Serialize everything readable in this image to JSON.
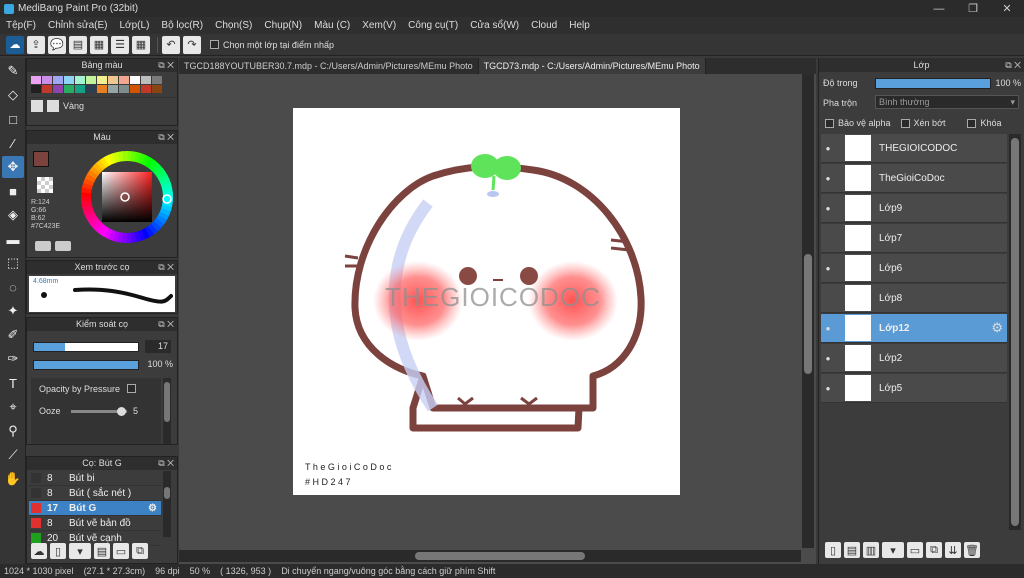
{
  "window": {
    "title": "MediBang Paint Pro (32bit)",
    "minimize": "—",
    "maximize": "❐",
    "close": "✕"
  },
  "menu": [
    "Tệp(F)",
    "Chỉnh sửa(E)",
    "Lớp(L)",
    "Bộ lọc(R)",
    "Chọn(S)",
    "Chụp(N)",
    "Màu (C)",
    "Xem(V)",
    "Công cụ(T)",
    "Cửa sổ(W)",
    "Cloud",
    "Help"
  ],
  "toolbar": {
    "select_layer_label": "Chọn một lớp tại điểm nhấp"
  },
  "palette": {
    "title": "Bảng màu",
    "colors": [
      "#e9a3f0",
      "#c98ee8",
      "#9fa6f2",
      "#8fd3f4",
      "#a3f2d2",
      "#c3f29d",
      "#f2f08f",
      "#f2c68f",
      "#f2a58f",
      "#ffffff",
      "#bdbdbd",
      "#7a7a7a",
      "#202020",
      "#c0392b",
      "#8e44ad",
      "#27ae60",
      "#16a085",
      "#2c3e50",
      "#e67e22",
      "#95a5a6",
      "#7f8c8d",
      "#d35400",
      "#c0392b",
      "#8b4513"
    ],
    "selected_name": "Vàng"
  },
  "color": {
    "title": "Màu",
    "r": "R:124",
    "g": "G:66",
    "b": "B:62",
    "hex": "#7C423E",
    "current": "#7c423e"
  },
  "brush_preview": {
    "title": "Xem trước cọ",
    "size": "4.68mm"
  },
  "brush_control": {
    "title": "Kiểm soát cọ",
    "size_value": "17",
    "opacity_value": "100 %",
    "size_fraction": 0.3,
    "opacity_fraction": 1.0,
    "pressure_label": "Opacity by Pressure",
    "ooze_label": "Ooze",
    "ooze_value": "5",
    "ooze_fraction": 0.9
  },
  "brushes": {
    "title": "Cọ: Bút G",
    "items": [
      {
        "size": "8",
        "name": "Bút bi",
        "color": "#333333"
      },
      {
        "size": "8",
        "name": "Bút ( sắc nét )",
        "color": "#333333"
      },
      {
        "size": "17",
        "name": "Bút G",
        "color": "#e03030",
        "selected": true
      },
      {
        "size": "8",
        "name": "Bút vẽ bản đồ",
        "color": "#e03030"
      },
      {
        "size": "20",
        "name": "Bút vẽ cạnh",
        "color": "#1fa01f"
      }
    ]
  },
  "tabs": [
    {
      "label": "TGCD188YOUTUBER30.7.mdp - C:/Users/Admin/Pictures/MEmu Photo",
      "active": false
    },
    {
      "label": "TGCD73.mdp - C:/Users/Admin/Pictures/MEmu Photo",
      "active": true
    }
  ],
  "artwork": {
    "watermark": "THEGIOICODOC",
    "credit_line1": "T h e G i o i C o D o c",
    "credit_line2": "# H D 2 4 7"
  },
  "layers": {
    "title": "Lớp",
    "opacity_label": "Độ trong",
    "opacity_value": "100 %",
    "opacity_fraction": 1.0,
    "blend_label": "Pha trộn",
    "blend_value": "Bình thường",
    "protect_alpha": "Bảo vệ alpha",
    "clipping": "Xén bớt",
    "lock": "Khóa",
    "items": [
      {
        "name": "THEGIOICODOC",
        "visible": true,
        "selected": false
      },
      {
        "name": "TheGioiCoDoc",
        "visible": true,
        "selected": false
      },
      {
        "name": "Lớp9",
        "visible": true,
        "selected": false
      },
      {
        "name": "Lớp7",
        "visible": false,
        "selected": false
      },
      {
        "name": "Lớp6",
        "visible": true,
        "selected": false
      },
      {
        "name": "Lớp8",
        "visible": false,
        "selected": false
      },
      {
        "name": "Lớp12",
        "visible": true,
        "selected": true
      },
      {
        "name": "Lớp2",
        "visible": true,
        "selected": false
      },
      {
        "name": "Lớp5",
        "visible": true,
        "selected": false
      }
    ]
  },
  "status": {
    "size": "1024 * 1030 pixel",
    "cm": "(27.1 * 27.3cm)",
    "dpi": "96 dpi",
    "zoom": "50 %",
    "coords": "( 1326, 953 )",
    "hint": "Di chuyển ngang/vuông góc bằng cách giữ phím Shift"
  }
}
